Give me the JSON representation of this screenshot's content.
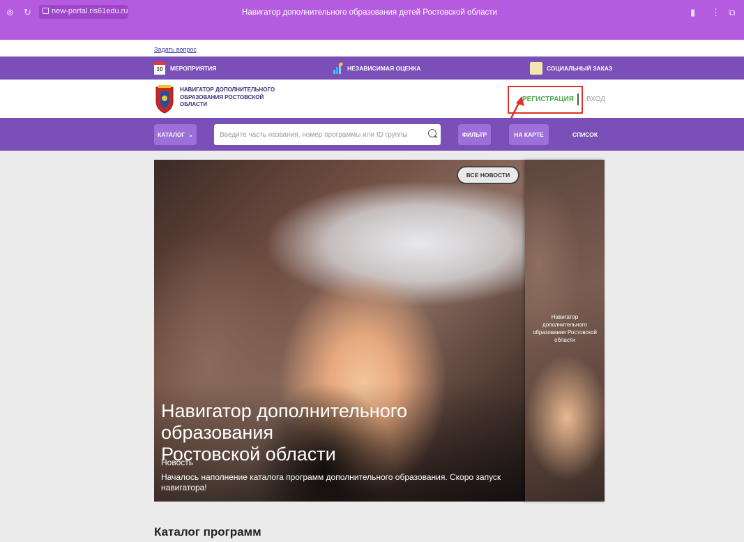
{
  "browser": {
    "url": "new-portal.ris61edu.ru",
    "title": "Навигатор дополнительного образования детей Ростовской области"
  },
  "top_link": "Задать вопрос",
  "top_nav": {
    "calendar_day": "10",
    "items": [
      "МЕРОПРИЯТИЯ",
      "НЕЗАВИСИМАЯ ОЦЕНКА",
      "СОЦИАЛЬНЫЙ ЗАКАЗ"
    ]
  },
  "header": {
    "logo_line1": "НАВИГАТОР ДОПОЛНИТЕЛЬНОГО",
    "logo_line2": "ОБРАЗОВАНИЯ РОСТОВСКОЙ",
    "logo_line3": "ОБЛАСТИ",
    "register": "РЕГИСТРАЦИЯ",
    "login": "ВХОД"
  },
  "search_bar": {
    "catalog": "КАТАЛОГ",
    "placeholder": "Введите часть названия, номер программы или ID группы",
    "filter": "ФИЛЬТР",
    "map": "НА КАРТЕ",
    "list": "СПИСОК"
  },
  "banner": {
    "all_news": "ВСЕ НОВОСТИ",
    "title_line1": "Навигатор дополнительного образования",
    "title_line2": "Ростовской области",
    "kind": "Новость",
    "desc_line1": "Началось наполнение каталога программ дополнительного образования. Скоро запуск",
    "desc_line2": "навигатора!",
    "side_line1": "Навигатор",
    "side_line2": "дополнительного",
    "side_line3": "образования Ростовской",
    "side_line4": "области"
  },
  "section_title": "Каталог программ"
}
